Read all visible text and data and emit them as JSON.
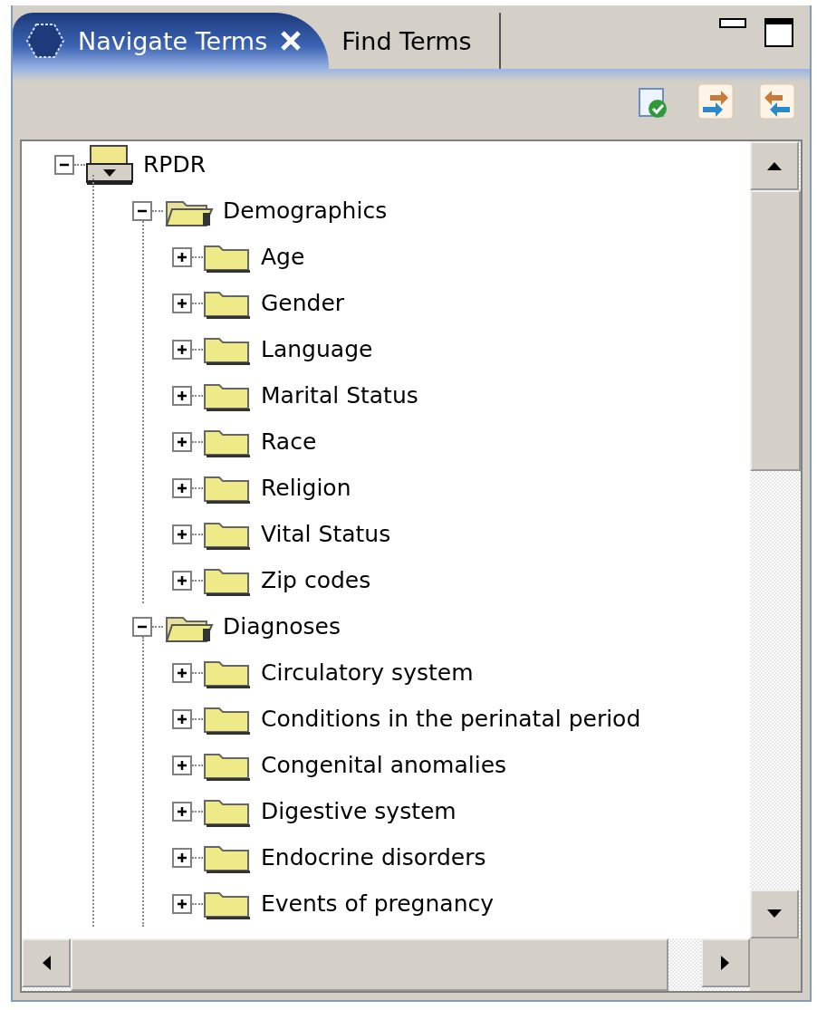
{
  "tabs": [
    {
      "label": "Navigate Terms",
      "selected": true
    },
    {
      "label": "Find Terms",
      "selected": false
    }
  ],
  "tree": [
    {
      "label": "RPDR",
      "kind": "drive",
      "expanded": true,
      "children": [
        {
          "label": "Demographics",
          "kind": "folder",
          "expanded": true,
          "children": [
            {
              "label": "Age",
              "kind": "folder",
              "expanded": false
            },
            {
              "label": "Gender",
              "kind": "folder",
              "expanded": false
            },
            {
              "label": "Language",
              "kind": "folder",
              "expanded": false
            },
            {
              "label": "Marital Status",
              "kind": "folder",
              "expanded": false
            },
            {
              "label": "Race",
              "kind": "folder",
              "expanded": false
            },
            {
              "label": "Religion",
              "kind": "folder",
              "expanded": false
            },
            {
              "label": "Vital Status",
              "kind": "folder",
              "expanded": false
            },
            {
              "label": "Zip codes",
              "kind": "folder",
              "expanded": false
            }
          ]
        },
        {
          "label": "Diagnoses",
          "kind": "folder",
          "expanded": true,
          "children": [
            {
              "label": "Circulatory system",
              "kind": "folder",
              "expanded": false
            },
            {
              "label": "Conditions in the perinatal period",
              "kind": "folder",
              "expanded": false
            },
            {
              "label": "Congenital anomalies",
              "kind": "folder",
              "expanded": false
            },
            {
              "label": "Digestive system",
              "kind": "folder",
              "expanded": false
            },
            {
              "label": "Endocrine disorders",
              "kind": "folder",
              "expanded": false
            },
            {
              "label": "Events of pregnancy",
              "kind": "folder",
              "expanded": false
            }
          ]
        }
      ]
    }
  ]
}
